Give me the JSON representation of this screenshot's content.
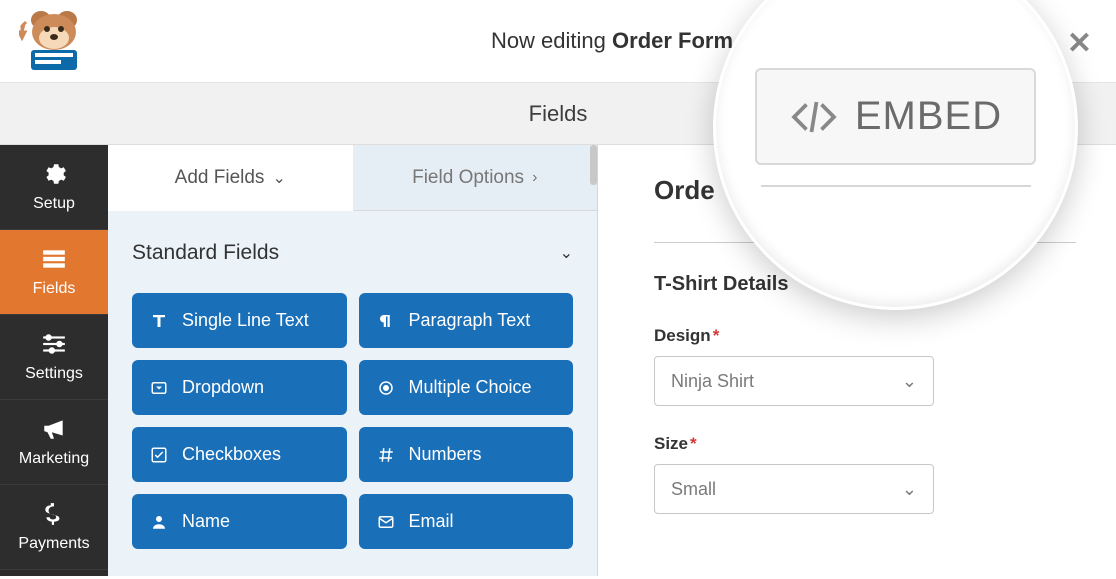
{
  "header": {
    "editing_prefix": "Now editing",
    "form_name": "Order Form"
  },
  "subheader": {
    "label": "Fields"
  },
  "sidebar": {
    "items": [
      {
        "label": "Setup",
        "icon": "gear"
      },
      {
        "label": "Fields",
        "icon": "list"
      },
      {
        "label": "Settings",
        "icon": "sliders"
      },
      {
        "label": "Marketing",
        "icon": "megaphone"
      },
      {
        "label": "Payments",
        "icon": "dollar"
      }
    ]
  },
  "tabs": {
    "add_fields": "Add Fields",
    "field_options": "Field Options"
  },
  "field_group": {
    "title": "Standard Fields"
  },
  "fields": [
    {
      "label": "Single Line Text"
    },
    {
      "label": "Paragraph Text"
    },
    {
      "label": "Dropdown"
    },
    {
      "label": "Multiple Choice"
    },
    {
      "label": "Checkboxes"
    },
    {
      "label": "Numbers"
    },
    {
      "label": "Name"
    },
    {
      "label": "Email"
    }
  ],
  "preview": {
    "title_fragment": "Orde",
    "section": "T-Shirt Details",
    "design_label": "Design",
    "design_value": "Ninja Shirt",
    "size_label": "Size",
    "size_value": "Small"
  },
  "embed": {
    "label": "EMBED"
  }
}
